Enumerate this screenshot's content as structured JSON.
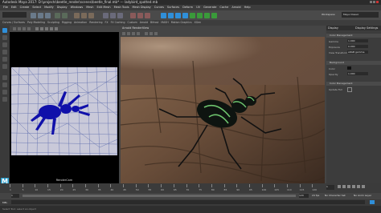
{
  "window": {
    "title": "Autodesk Maya 2017: D:\\projects\\beetle_render\\scenes\\beetle_final.mb* --- ladybird_spotted.mb",
    "workspace_label": "Workspace:",
    "workspace_value": "Maya Classic"
  },
  "menu": [
    "File",
    "Edit",
    "Create",
    "Select",
    "Modify",
    "Display",
    "Windows",
    "Mesh",
    "Edit Mesh",
    "Mesh Tools",
    "Mesh Display",
    "Curves",
    "Surfaces",
    "Deform",
    "UV",
    "Generate",
    "Cache",
    "Arnold",
    "Help"
  ],
  "shelf_tabs": [
    "Curves / Surfaces",
    "Poly Modeling",
    "Sculpting",
    "Rigging",
    "Animation",
    "Rendering",
    "FX",
    "FX Caching",
    "Custom",
    "Arnold",
    "Bifrost",
    "MASH",
    "Motion Graphics",
    "XGen"
  ],
  "viewport": {
    "camera_label": "RenderCam"
  },
  "render_view": {
    "title": "Arnold RenderView"
  },
  "panel": {
    "tabs": [
      "Display",
      "Display Settings"
    ],
    "section1": "Color Management",
    "rows": [
      {
        "label": "Gamma",
        "value": "1.000"
      },
      {
        "label": "Exposure",
        "value": "0.000"
      },
      {
        "label": "View Transform",
        "value": "sRGB gamma"
      }
    ],
    "section2": "Background",
    "rows2": [
      {
        "label": "Color",
        "value": ""
      },
      {
        "label": "Opacity",
        "value": "1.000"
      }
    ],
    "section3": "Color Management",
    "rows3": [
      {
        "label": "Update Full",
        "value": ""
      }
    ]
  },
  "timeline": {
    "ticks": [
      "1",
      "5",
      "10",
      "15",
      "20",
      "25",
      "30",
      "35",
      "40",
      "45",
      "50",
      "55",
      "60",
      "65",
      "70",
      "75",
      "80",
      "85",
      "90",
      "95",
      "100",
      "105",
      "110",
      "115",
      "120"
    ],
    "current": "1"
  },
  "range": {
    "start": "1",
    "end": "120",
    "fps": "24 fps",
    "no_char": "No Character Set",
    "no_anim": "No Anim Layer"
  },
  "cmdline": {
    "lang": "MEL"
  },
  "help": {
    "text": "Select Tool: select an object"
  },
  "colors": {
    "accent": "#2f8fd9",
    "bg": "#444444"
  }
}
